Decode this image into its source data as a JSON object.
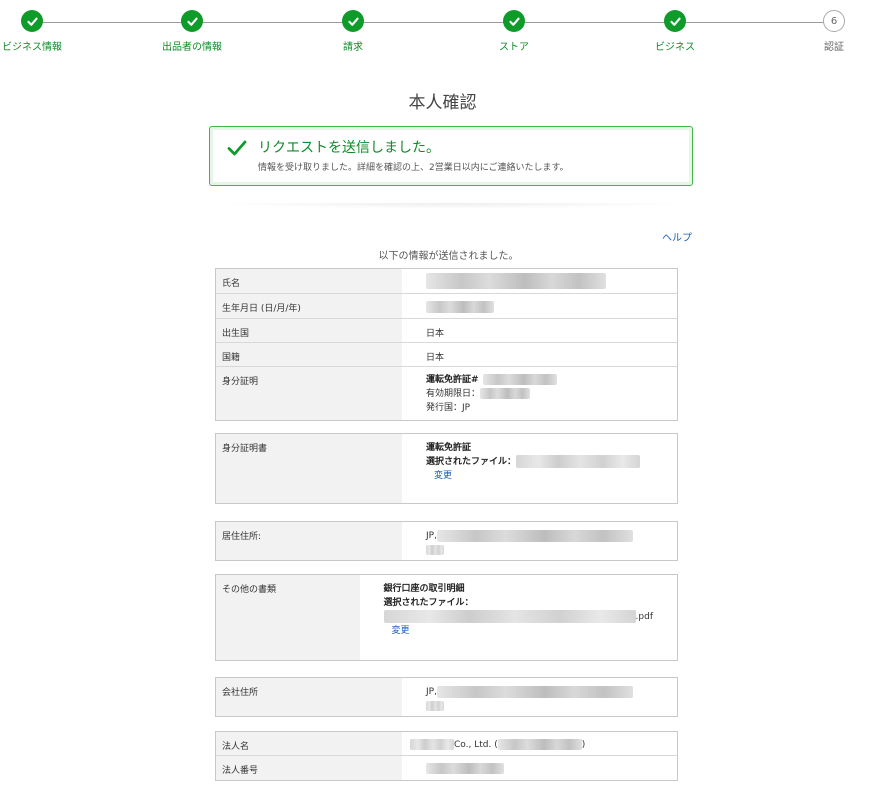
{
  "stepper": {
    "steps": [
      {
        "label": "ビジネス情報",
        "status": "done"
      },
      {
        "label": "出品者の情報",
        "status": "done"
      },
      {
        "label": "請求",
        "status": "done"
      },
      {
        "label": "ストア",
        "status": "done"
      },
      {
        "label": "ビジネス",
        "status": "done"
      },
      {
        "label": "認証",
        "status": "current",
        "number": "6"
      }
    ]
  },
  "page_title": "本人確認",
  "alert": {
    "title": "リクエストを送信しました。",
    "message": "情報を受け取りました。詳細を確認の上、2営業日以内にご連絡いたします。",
    "icon": "check-icon"
  },
  "help_link": "ヘルプ",
  "sent_note": "以下の情報が送信されました。",
  "personal": {
    "name_label": "氏名",
    "dob_label": "生年月日 (日/月/年)",
    "birth_country_label": "出生国",
    "birth_country_value": "日本",
    "nationality_label": "国籍",
    "nationality_value": "日本",
    "id_label": "身分証明",
    "id_type_line": "運転免許証#",
    "id_expiry_line": "有効期限日：",
    "id_country_line": "発行国：JP"
  },
  "id_document": {
    "label": "身分証明書",
    "doc_type": "運転免許証",
    "file_label": "選択されたファイル：",
    "change_link": "変更"
  },
  "residence": {
    "label": "居住住所:",
    "value_prefix": "JP,"
  },
  "other_docs": {
    "label": "その他の書類",
    "doc_type": "銀行口座の取引明細",
    "file_label": "選択されたファイル：",
    "file_ext": ".pdf",
    "change_link": "変更"
  },
  "company_address": {
    "label": "会社住所",
    "value_prefix": "JP,"
  },
  "company": {
    "name_label": "法人名",
    "name_middle": "Co., Ltd. (",
    "name_suffix": ")",
    "number_label": "法人番号"
  },
  "colors": {
    "accent_green": "#0f9b2a",
    "link_blue": "#1a5db8",
    "alert_border": "#3fb54a"
  }
}
